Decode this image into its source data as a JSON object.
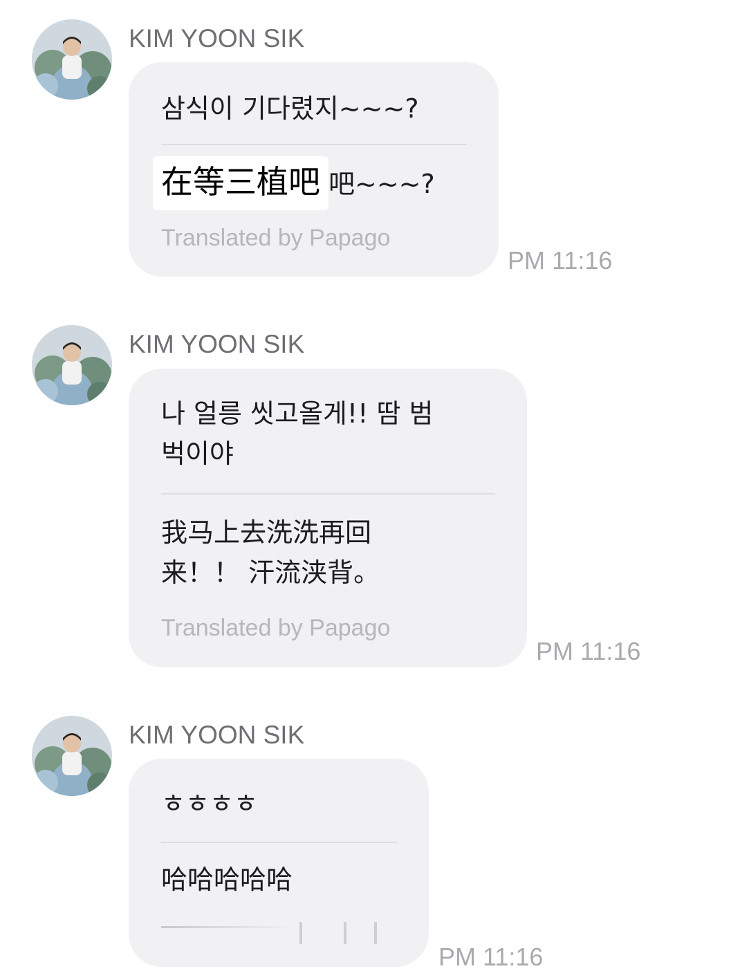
{
  "messages": [
    {
      "sender": "KIM YOON SIK",
      "original": "삼식이 기다렸지~~~?",
      "translation_highlight": "在等三植吧",
      "translation_rest": "吧~~~?",
      "translated_by": "Translated by Papago",
      "time": "PM 11:16"
    },
    {
      "sender": "KIM YOON SIK",
      "original_line1": "나 얼릉 씻고올게!! 땀 범",
      "original_line2": "벅이야",
      "translation_line1": "我马上去洗洗再回",
      "translation_line2": "来！！ 汗流浃背。",
      "translated_by": "Translated by Papago",
      "time": "PM 11:16"
    },
    {
      "sender": "KIM YOON SIK",
      "original": "ㅎㅎㅎㅎ",
      "translation": "哈哈哈哈哈",
      "time": "PM 11:16"
    }
  ],
  "icons": {
    "avatar": "profile-photo-man-with-flowers",
    "loading": "translation-loading-indicator"
  },
  "colors": {
    "bubble": "#f1f1f3",
    "sender": "#6e6e73",
    "time": "#a9a9ae",
    "translated_by": "#b6b6bc",
    "divider": "#dedee2"
  }
}
